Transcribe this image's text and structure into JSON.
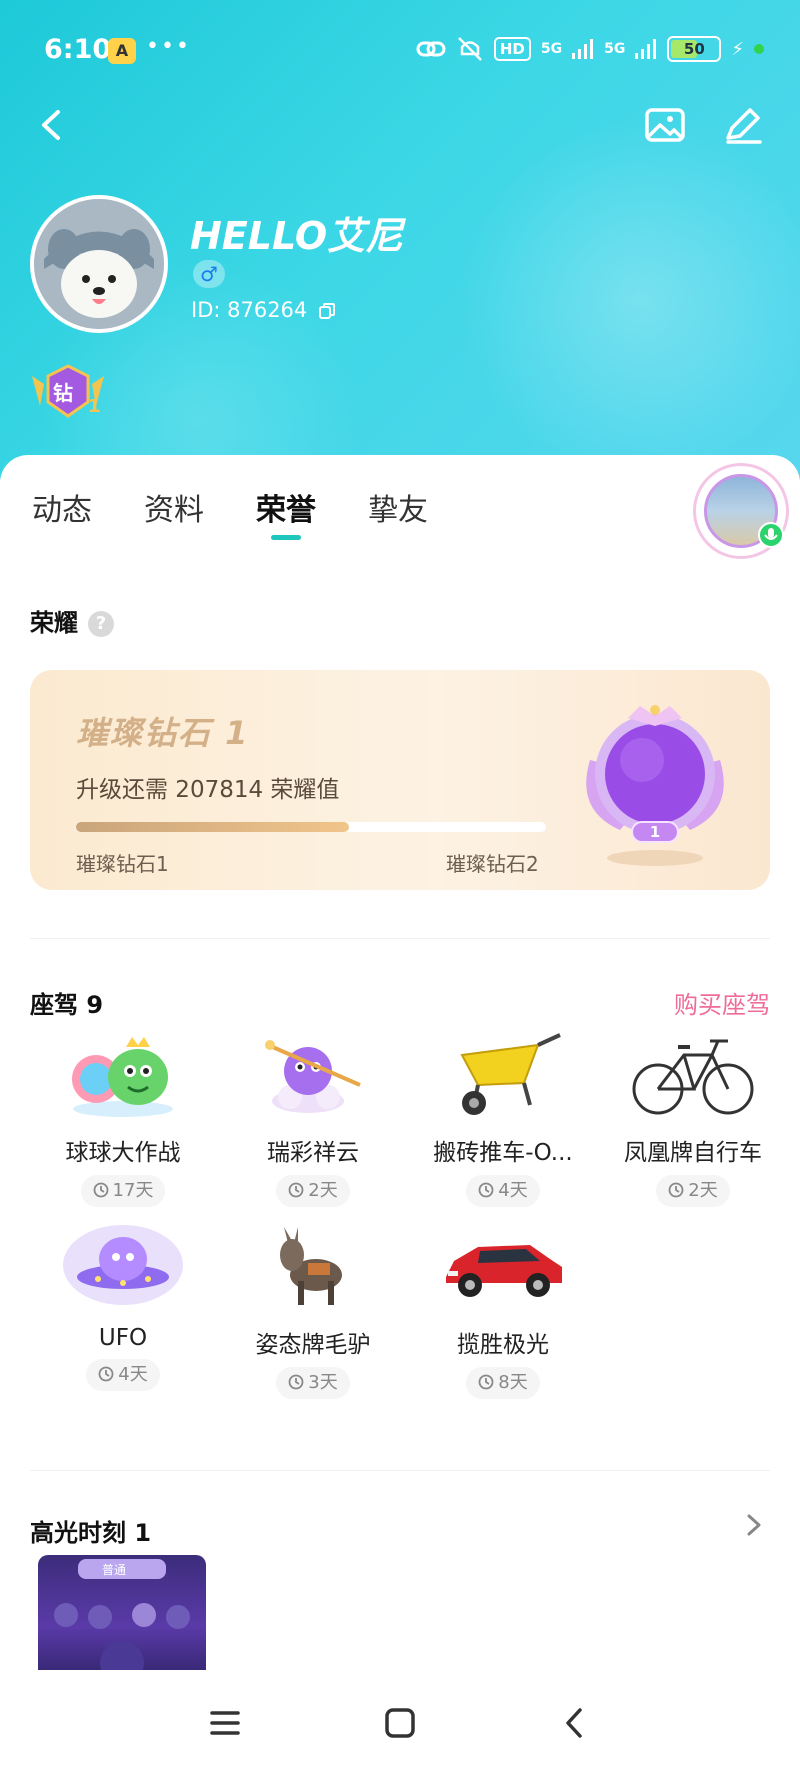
{
  "status_bar": {
    "time": "6:10",
    "app_badge": "A",
    "more": "•••",
    "hd": "HD",
    "signal1": "5G",
    "signal2": "5G",
    "battery": "50"
  },
  "header": {
    "icons": [
      "back-icon",
      "image-icon",
      "edit-icon"
    ]
  },
  "profile": {
    "name": "HELLO艾尼",
    "gender_symbol": "♂",
    "id_text": "ID: 876264",
    "vip_badge_text": "钻1"
  },
  "tabs": [
    {
      "label": "动态",
      "active": false
    },
    {
      "label": "资料",
      "active": false
    },
    {
      "label": "荣誉",
      "active": true
    },
    {
      "label": "挚友",
      "active": false
    }
  ],
  "honor": {
    "section_title": "荣耀",
    "help": "?",
    "level_title": "璀璨钻石 1",
    "need_text": "升级还需 207814 荣耀值",
    "progress": 0.58,
    "from_level": "璀璨钻石1",
    "to_level": "璀璨钻石2",
    "medal_number": "1"
  },
  "vehicles": {
    "section_title": "座驾 9",
    "buy_label": "购买座驾",
    "items": [
      {
        "name": "球球大作战",
        "days": "17天",
        "icon": "ball-battle-mount"
      },
      {
        "name": "瑞彩祥云",
        "days": "2天",
        "icon": "cloud-mount"
      },
      {
        "name": "搬砖推车-O...",
        "days": "4天",
        "icon": "wheelbarrow"
      },
      {
        "name": "凤凰牌自行车",
        "days": "2天",
        "icon": "bicycle"
      },
      {
        "name": "UFO",
        "days": "4天",
        "icon": "ufo"
      },
      {
        "name": "姿态牌毛驴",
        "days": "3天",
        "icon": "donkey"
      },
      {
        "name": "揽胜极光",
        "days": "8天",
        "icon": "red-suv"
      }
    ]
  },
  "highlights": {
    "section_title": "高光时刻 1",
    "thumb_label": "普通"
  },
  "nav": {
    "icons": [
      "menu-icon",
      "home-icon",
      "back-icon"
    ]
  },
  "colors": {
    "header": "#1ec9d8",
    "accent": "#1ec6bd",
    "buy_link": "#ef6c9a",
    "honor_gold": "#d4b089"
  }
}
